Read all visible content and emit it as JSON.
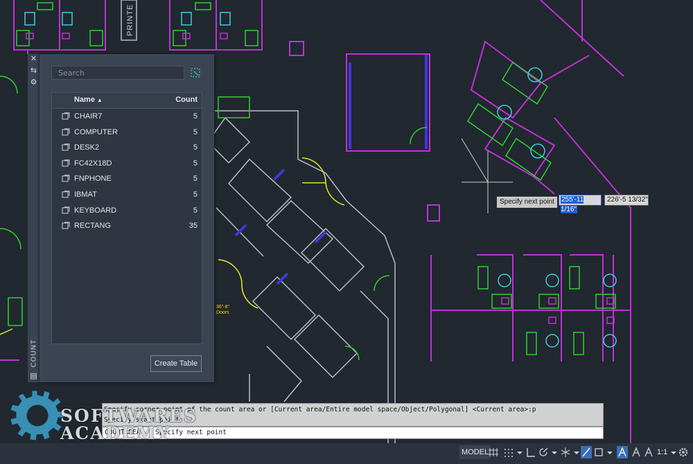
{
  "count_panel": {
    "title": "COUNT",
    "close_icon": "close-icon",
    "pin_icon": "autohide-icon",
    "settings_icon": "properties-icon",
    "search_placeholder": "Search",
    "columns": {
      "name": "Name",
      "sort_indicator": "▲",
      "count": "Count"
    },
    "items": [
      {
        "name": "CHAIR7",
        "count": "5"
      },
      {
        "name": "COMPUTER",
        "count": "5"
      },
      {
        "name": "DESK2",
        "count": "5"
      },
      {
        "name": "FC42X18D",
        "count": "5"
      },
      {
        "name": "FNPHONE",
        "count": "5"
      },
      {
        "name": "IBMAT",
        "count": "5"
      },
      {
        "name": "KEYBOARD",
        "count": "5"
      },
      {
        "name": "RECTANG",
        "count": "35"
      }
    ],
    "create_table_label": "Create Table"
  },
  "drawing": {
    "printer_label": "PRINTE",
    "doors_label_1": "36\"-8\"",
    "doors_label_2": "Doors"
  },
  "cursor_tooltip": {
    "prompt": "Specify next point",
    "distance": "255'-11 1/16\"",
    "angle": "226'-5 13/32\""
  },
  "command_line": {
    "history_1": "Specify corner point of the count area or [Current area/Entire model space/Object/Polygonal] <Current area>:p",
    "history_2": "Specify start point:",
    "current": "Specify next point",
    "prefix": "COUNTAREA"
  },
  "status_bar": {
    "model_label": "MODEL",
    "scale_label": "1:1"
  },
  "watermark": {
    "line1": "SOFTWARES",
    "line2": "ACADEMY"
  },
  "colors": {
    "background": "#212830",
    "magenta": "#c130d6",
    "green": "#2fd12f",
    "cyan": "#3ccfe0",
    "yellow": "#e6e62a",
    "blue": "#3a3ad8",
    "gray": "#b9bec5"
  }
}
